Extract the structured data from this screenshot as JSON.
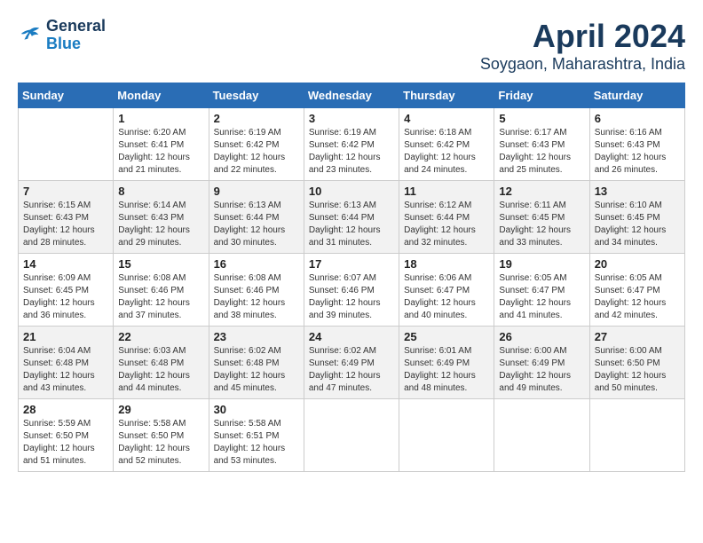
{
  "header": {
    "logo_line1": "General",
    "logo_line2": "Blue",
    "title": "April 2024",
    "subtitle": "Soygaon, Maharashtra, India"
  },
  "calendar": {
    "weekdays": [
      "Sunday",
      "Monday",
      "Tuesday",
      "Wednesday",
      "Thursday",
      "Friday",
      "Saturday"
    ],
    "weeks": [
      [
        {
          "date": "",
          "sunrise": "",
          "sunset": "",
          "daylight": ""
        },
        {
          "date": "1",
          "sunrise": "6:20 AM",
          "sunset": "6:41 PM",
          "daylight": "12 hours and 21 minutes."
        },
        {
          "date": "2",
          "sunrise": "6:19 AM",
          "sunset": "6:42 PM",
          "daylight": "12 hours and 22 minutes."
        },
        {
          "date": "3",
          "sunrise": "6:19 AM",
          "sunset": "6:42 PM",
          "daylight": "12 hours and 23 minutes."
        },
        {
          "date": "4",
          "sunrise": "6:18 AM",
          "sunset": "6:42 PM",
          "daylight": "12 hours and 24 minutes."
        },
        {
          "date": "5",
          "sunrise": "6:17 AM",
          "sunset": "6:43 PM",
          "daylight": "12 hours and 25 minutes."
        },
        {
          "date": "6",
          "sunrise": "6:16 AM",
          "sunset": "6:43 PM",
          "daylight": "12 hours and 26 minutes."
        }
      ],
      [
        {
          "date": "7",
          "sunrise": "6:15 AM",
          "sunset": "6:43 PM",
          "daylight": "12 hours and 28 minutes."
        },
        {
          "date": "8",
          "sunrise": "6:14 AM",
          "sunset": "6:43 PM",
          "daylight": "12 hours and 29 minutes."
        },
        {
          "date": "9",
          "sunrise": "6:13 AM",
          "sunset": "6:44 PM",
          "daylight": "12 hours and 30 minutes."
        },
        {
          "date": "10",
          "sunrise": "6:13 AM",
          "sunset": "6:44 PM",
          "daylight": "12 hours and 31 minutes."
        },
        {
          "date": "11",
          "sunrise": "6:12 AM",
          "sunset": "6:44 PM",
          "daylight": "12 hours and 32 minutes."
        },
        {
          "date": "12",
          "sunrise": "6:11 AM",
          "sunset": "6:45 PM",
          "daylight": "12 hours and 33 minutes."
        },
        {
          "date": "13",
          "sunrise": "6:10 AM",
          "sunset": "6:45 PM",
          "daylight": "12 hours and 34 minutes."
        }
      ],
      [
        {
          "date": "14",
          "sunrise": "6:09 AM",
          "sunset": "6:45 PM",
          "daylight": "12 hours and 36 minutes."
        },
        {
          "date": "15",
          "sunrise": "6:08 AM",
          "sunset": "6:46 PM",
          "daylight": "12 hours and 37 minutes."
        },
        {
          "date": "16",
          "sunrise": "6:08 AM",
          "sunset": "6:46 PM",
          "daylight": "12 hours and 38 minutes."
        },
        {
          "date": "17",
          "sunrise": "6:07 AM",
          "sunset": "6:46 PM",
          "daylight": "12 hours and 39 minutes."
        },
        {
          "date": "18",
          "sunrise": "6:06 AM",
          "sunset": "6:47 PM",
          "daylight": "12 hours and 40 minutes."
        },
        {
          "date": "19",
          "sunrise": "6:05 AM",
          "sunset": "6:47 PM",
          "daylight": "12 hours and 41 minutes."
        },
        {
          "date": "20",
          "sunrise": "6:05 AM",
          "sunset": "6:47 PM",
          "daylight": "12 hours and 42 minutes."
        }
      ],
      [
        {
          "date": "21",
          "sunrise": "6:04 AM",
          "sunset": "6:48 PM",
          "daylight": "12 hours and 43 minutes."
        },
        {
          "date": "22",
          "sunrise": "6:03 AM",
          "sunset": "6:48 PM",
          "daylight": "12 hours and 44 minutes."
        },
        {
          "date": "23",
          "sunrise": "6:02 AM",
          "sunset": "6:48 PM",
          "daylight": "12 hours and 45 minutes."
        },
        {
          "date": "24",
          "sunrise": "6:02 AM",
          "sunset": "6:49 PM",
          "daylight": "12 hours and 47 minutes."
        },
        {
          "date": "25",
          "sunrise": "6:01 AM",
          "sunset": "6:49 PM",
          "daylight": "12 hours and 48 minutes."
        },
        {
          "date": "26",
          "sunrise": "6:00 AM",
          "sunset": "6:49 PM",
          "daylight": "12 hours and 49 minutes."
        },
        {
          "date": "27",
          "sunrise": "6:00 AM",
          "sunset": "6:50 PM",
          "daylight": "12 hours and 50 minutes."
        }
      ],
      [
        {
          "date": "28",
          "sunrise": "5:59 AM",
          "sunset": "6:50 PM",
          "daylight": "12 hours and 51 minutes."
        },
        {
          "date": "29",
          "sunrise": "5:58 AM",
          "sunset": "6:50 PM",
          "daylight": "12 hours and 52 minutes."
        },
        {
          "date": "30",
          "sunrise": "5:58 AM",
          "sunset": "6:51 PM",
          "daylight": "12 hours and 53 minutes."
        },
        {
          "date": "",
          "sunrise": "",
          "sunset": "",
          "daylight": ""
        },
        {
          "date": "",
          "sunrise": "",
          "sunset": "",
          "daylight": ""
        },
        {
          "date": "",
          "sunrise": "",
          "sunset": "",
          "daylight": ""
        },
        {
          "date": "",
          "sunrise": "",
          "sunset": "",
          "daylight": ""
        }
      ]
    ]
  }
}
